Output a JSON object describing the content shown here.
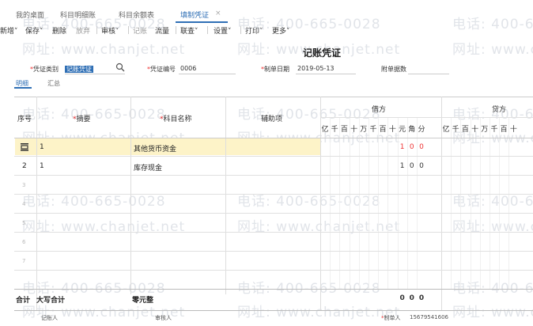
{
  "tabs": [
    {
      "label": "我的桌面"
    },
    {
      "label": "科目明细账"
    },
    {
      "label": "科目余额表"
    },
    {
      "label": "填制凭证"
    }
  ],
  "tab_close": "×",
  "toolbar": {
    "add": "新增˅",
    "save": "保存˅",
    "delete": "删除",
    "abandon": "放弃",
    "audit": "审核˅",
    "post": "记账",
    "flow": "流量",
    "query": "联查˅",
    "settings": "设置˅",
    "print": "打印˅",
    "more": "更多˅"
  },
  "voucher": {
    "title": "记账凭证",
    "type_label": "凭证类别",
    "type_value": "记账凭证",
    "number_label": "凭证编号",
    "number_value": "0006",
    "date_label": "制单日期",
    "date_value": "2019-05-13",
    "attachments_label": "附单据数"
  },
  "subtabs": {
    "detail": "明细",
    "summary": "汇总"
  },
  "table": {
    "headers": {
      "seq": "序号",
      "summary": "摘要",
      "account": "科目名称",
      "aux": "辅助项",
      "debit": "借方",
      "credit": "贷方"
    },
    "debit_units": [
      "亿",
      "千",
      "百",
      "十",
      "万",
      "千",
      "百",
      "十",
      "元",
      "角",
      "分"
    ],
    "credit_units": [
      "亿",
      "千",
      "百",
      "十",
      "万",
      "千",
      "百",
      "十"
    ],
    "rows": [
      {
        "seq": "",
        "summary": "1",
        "account": "其他货币资金",
        "debit": [
          "1",
          "0",
          "0"
        ]
      },
      {
        "seq": "2",
        "summary": "1",
        "account": "库存现金",
        "debit": [
          "1",
          "0",
          "0"
        ]
      },
      {
        "seq": "3"
      },
      {
        "seq": "4"
      },
      {
        "seq": "5"
      },
      {
        "seq": "6"
      },
      {
        "seq": "7"
      }
    ],
    "total_label": "合计",
    "total_uppercase_label": "大写合计",
    "total_uppercase_value": "零元整",
    "total_debit": [
      "0",
      "0",
      "0"
    ]
  },
  "footer": {
    "bookkeeper": "记账人",
    "auditor": "审核人",
    "creator_label": "制单人",
    "creator_value": "15679541606"
  },
  "watermark": {
    "phone": "电话: 400-665-0028",
    "site": "网址: www.chanjet.net"
  },
  "colors": {
    "accent": "#2f6fb5",
    "required": "#ee3333",
    "highlight": "#fdf3c8"
  }
}
